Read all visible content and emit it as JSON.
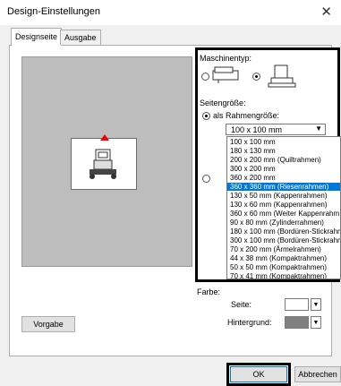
{
  "window": {
    "title": "Design-Einstellungen"
  },
  "tabs": [
    {
      "label": "Designseite"
    },
    {
      "label": "Ausgabe"
    }
  ],
  "machine_type": {
    "label": "Maschinentyp:"
  },
  "page_size": {
    "label": "Seitengröße:",
    "radio_frame_label": "als Rahmengröße:",
    "selected_value": "100 x 100 mm"
  },
  "frame_options": [
    "100 x 100 mm",
    "180 x 130 mm",
    "200 x 200 mm (Quiltrahmen)",
    "300 x 200 mm",
    "360 x 200 mm",
    "360 x 360 mm (Riesenrahmen)",
    "130 x  50 mm (Kappenrahmen)",
    "130 x  60 mm (Kappenrahmen)",
    "360 x  60 mm (Weiter Kappenrahm",
    " 90 x  80 mm (Zylinderrahmen)",
    "180 x 100 mm (Bordüren-Stickrahm",
    "300 x 100 mm (Bordüren-Stickrahm",
    " 70 x 200 mm (Ärmelrahmen)",
    " 44 x  38 mm (Kompaktrahmen)",
    " 50 x  50 mm (Kompaktrahmen)",
    " 70 x  41 mm (Kompaktrahmen)"
  ],
  "selected_index": 5,
  "color": {
    "label": "Farbe:",
    "page_label": "Seite:",
    "background_label": "Hintergrund:",
    "page_color": "#ffffff",
    "background_color": "#808080"
  },
  "buttons": {
    "default": "Vorgabe",
    "ok": "OK",
    "cancel": "Abbrechen"
  }
}
